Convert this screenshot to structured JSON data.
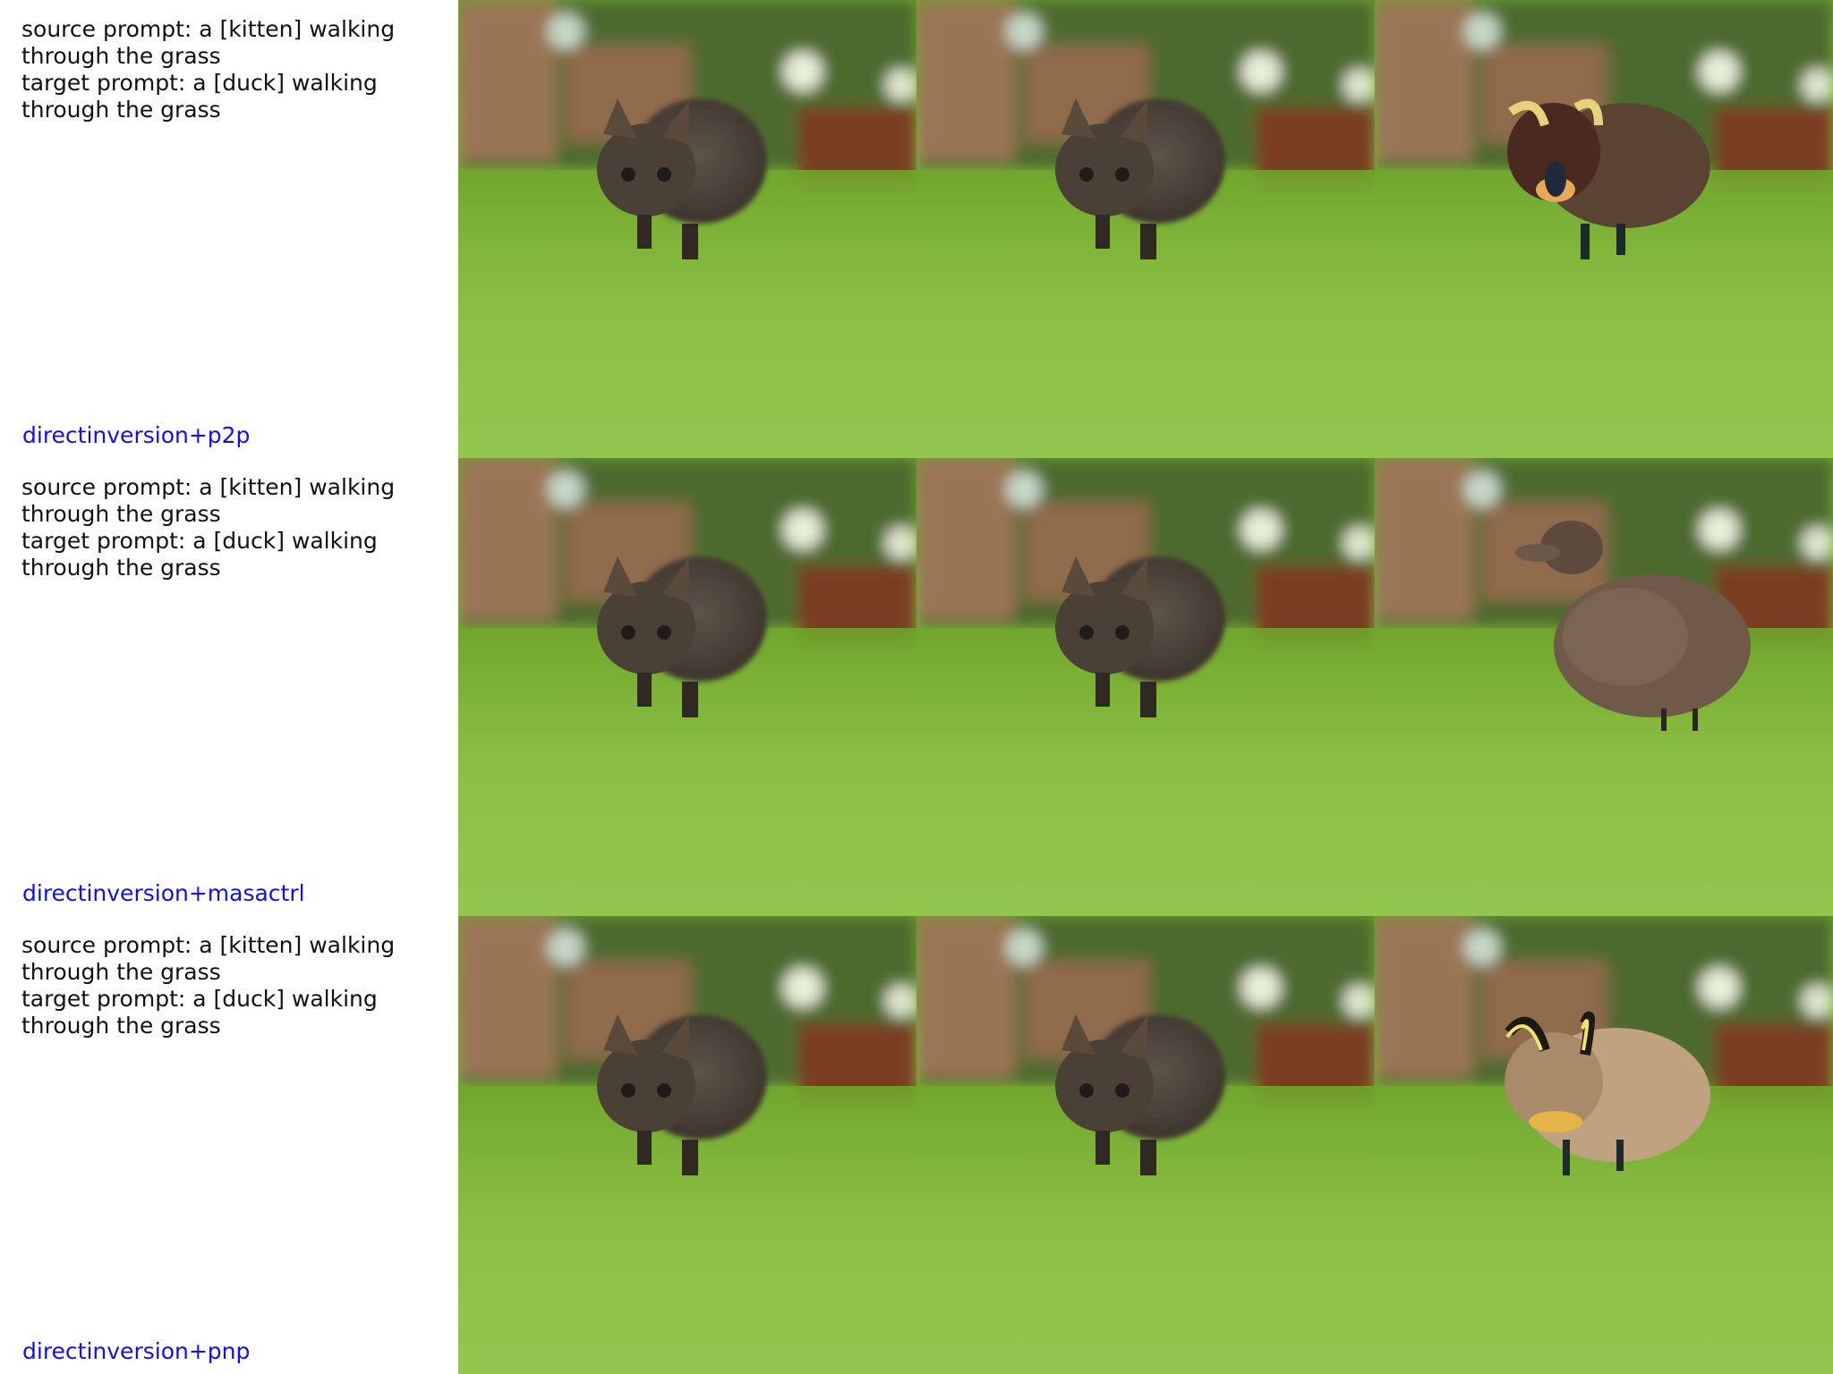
{
  "rows": [
    {
      "source_prompt": "source prompt: a [kitten] walking through the grass",
      "target_prompt": "target prompt: a [duck] walking through the grass",
      "method": "directinversion+p2p",
      "images": [
        "kitten-source",
        "kitten-reconstruction",
        "duck-edit-p2p"
      ]
    },
    {
      "source_prompt": "source prompt: a [kitten] walking through the grass",
      "target_prompt": "target prompt: a [duck] walking through the grass",
      "method": "directinversion+masactrl",
      "images": [
        "kitten-source",
        "kitten-reconstruction",
        "duck-edit-masactrl"
      ]
    },
    {
      "source_prompt": "source prompt: a [kitten] walking through the grass",
      "target_prompt": "target prompt: a [duck] walking through the grass",
      "method": "directinversion+pnp",
      "images": [
        "kitten-source",
        "kitten-reconstruction",
        "duck-edit-pnp"
      ]
    }
  ],
  "colors": {
    "method_label": "#1010ee",
    "prompt_text": "#111111",
    "grass": "#7fb53a",
    "wall": "#9a7455",
    "foliage": "#4d6b2e"
  }
}
